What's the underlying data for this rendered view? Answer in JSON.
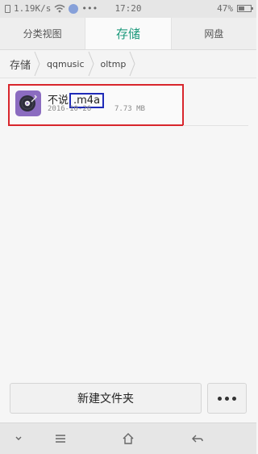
{
  "status_bar": {
    "network_speed": "1.19K/s",
    "dots": "•••",
    "time": "17:20",
    "battery_percent": "47%",
    "icons": [
      "sim-card-icon",
      "wifi-icon",
      "notification-icon",
      "battery-icon"
    ]
  },
  "tabs": [
    {
      "label": "分类视图",
      "active": false
    },
    {
      "label": "存储",
      "active": true
    },
    {
      "label": "网盘",
      "active": false
    }
  ],
  "breadcrumb": [
    "存储",
    "qqmusic",
    "oltmp"
  ],
  "files": [
    {
      "name": "不说",
      "extension": ".m4a",
      "date": "2016-10-26",
      "size": "7.73 MB",
      "icon": "music-file-icon"
    }
  ],
  "actions": {
    "new_folder_label": "新建文件夹",
    "more_icon": "more-icon"
  },
  "nav_bar": {
    "icons": [
      "chevron-down-icon",
      "menu-icon",
      "home-icon",
      "back-icon"
    ]
  },
  "colors": {
    "accent": "#1d9a7c",
    "highlight_red": "#d8262c",
    "highlight_blue": "#1f2bb8",
    "file_icon": "#8b6cc0"
  }
}
